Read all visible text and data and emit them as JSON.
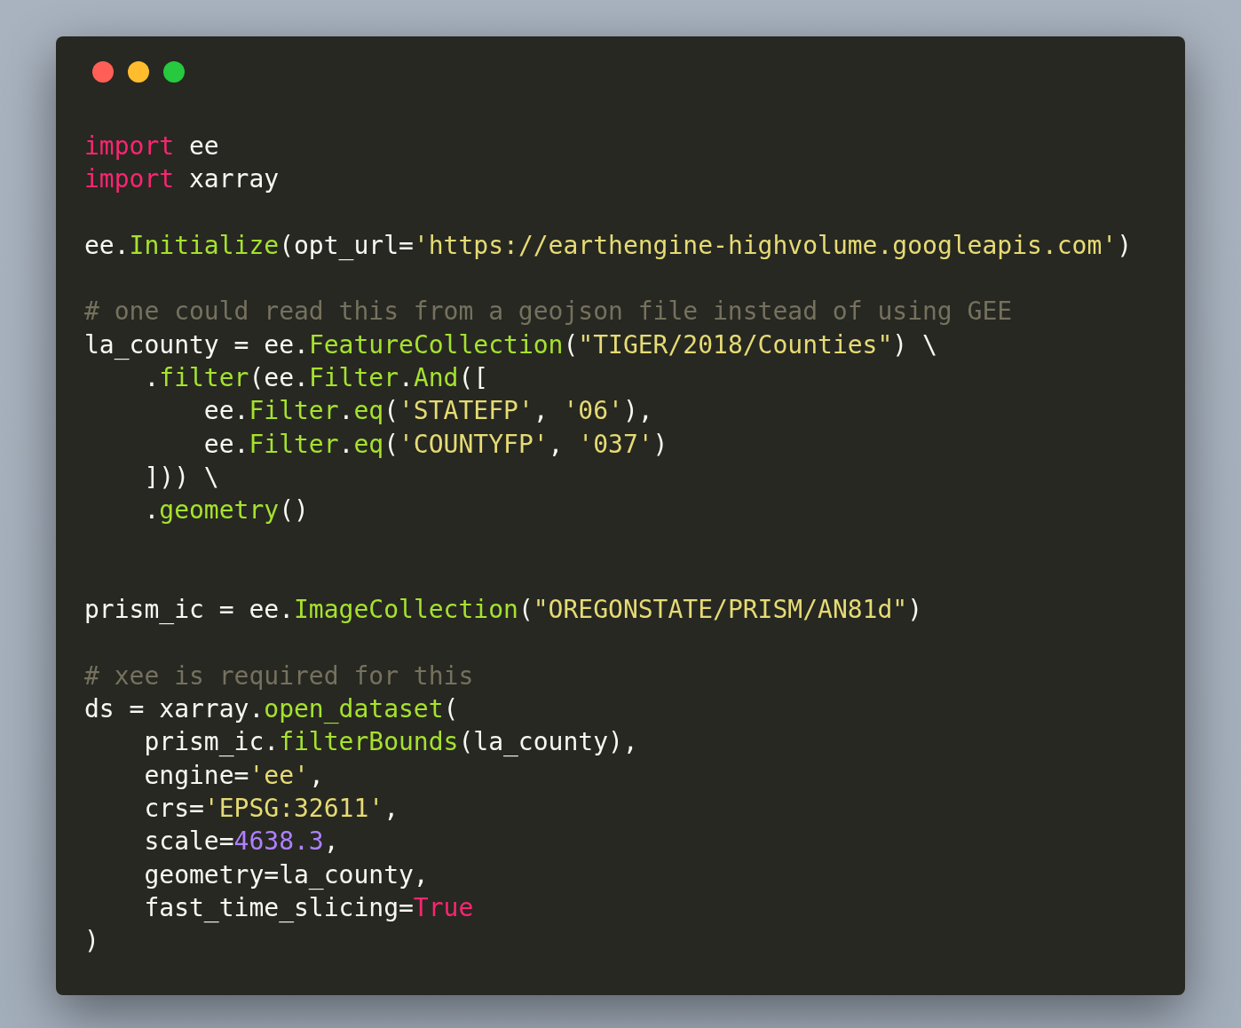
{
  "window": {
    "controls": [
      {
        "kind": "close"
      },
      {
        "kind": "minimize"
      },
      {
        "kind": "zoom"
      }
    ]
  },
  "code": {
    "lines": [
      {
        "kind": "code",
        "tokens": [
          {
            "kind": "keyword",
            "text": "import"
          },
          {
            "kind": "plain",
            "text": " ee"
          }
        ]
      },
      {
        "kind": "code",
        "tokens": [
          {
            "kind": "keyword",
            "text": "import"
          },
          {
            "kind": "plain",
            "text": " xarray"
          }
        ]
      },
      {
        "kind": "blank"
      },
      {
        "kind": "code",
        "tokens": [
          {
            "kind": "plain",
            "text": "ee."
          },
          {
            "kind": "function",
            "text": "Initialize"
          },
          {
            "kind": "plain",
            "text": "(opt_url="
          },
          {
            "kind": "string",
            "text": "'https://earthengine-highvolume.googleapis.com'"
          },
          {
            "kind": "plain",
            "text": ")"
          }
        ]
      },
      {
        "kind": "blank"
      },
      {
        "kind": "code",
        "tokens": [
          {
            "kind": "comment",
            "text": "# one could read this from a geojson file instead of using GEE"
          }
        ]
      },
      {
        "kind": "code",
        "tokens": [
          {
            "kind": "plain",
            "text": "la_county = ee."
          },
          {
            "kind": "function",
            "text": "FeatureCollection"
          },
          {
            "kind": "plain",
            "text": "("
          },
          {
            "kind": "string",
            "text": "\"TIGER/2018/Counties\""
          },
          {
            "kind": "plain",
            "text": ") \\"
          }
        ],
        "children": [
          {
            "kind": "code",
            "tokens": [
              {
                "kind": "member",
                "text": ".filter"
              },
              {
                "kind": "plain",
                "text": "(ee."
              },
              {
                "kind": "function",
                "text": "Filter"
              },
              {
                "kind": "member",
                "text": ".And"
              },
              {
                "kind": "plain",
                "text": "(["
              }
            ],
            "children": [
              {
                "kind": "code",
                "tokens": [
                  {
                    "kind": "plain",
                    "text": "ee."
                  },
                  {
                    "kind": "function",
                    "text": "Filter"
                  },
                  {
                    "kind": "member",
                    "text": ".eq"
                  },
                  {
                    "kind": "plain",
                    "text": "("
                  },
                  {
                    "kind": "string",
                    "text": "'STATEFP'"
                  },
                  {
                    "kind": "plain",
                    "text": ", "
                  },
                  {
                    "kind": "string",
                    "text": "'06'"
                  },
                  {
                    "kind": "plain",
                    "text": "),"
                  }
                ]
              },
              {
                "kind": "code",
                "tokens": [
                  {
                    "kind": "plain",
                    "text": "ee."
                  },
                  {
                    "kind": "function",
                    "text": "Filter"
                  },
                  {
                    "kind": "member",
                    "text": ".eq"
                  },
                  {
                    "kind": "plain",
                    "text": "("
                  },
                  {
                    "kind": "string",
                    "text": "'COUNTYFP'"
                  },
                  {
                    "kind": "plain",
                    "text": ", "
                  },
                  {
                    "kind": "string",
                    "text": "'037'"
                  },
                  {
                    "kind": "plain",
                    "text": ")"
                  }
                ]
              }
            ]
          },
          {
            "kind": "code",
            "tokens": [
              {
                "kind": "plain",
                "text": "])) \\"
              }
            ]
          },
          {
            "kind": "code",
            "tokens": [
              {
                "kind": "member",
                "text": ".geometry"
              },
              {
                "kind": "plain",
                "text": "()"
              }
            ]
          }
        ]
      },
      {
        "kind": "blank"
      },
      {
        "kind": "blank"
      },
      {
        "kind": "code",
        "tokens": [
          {
            "kind": "plain",
            "text": "prism_ic = ee."
          },
          {
            "kind": "function",
            "text": "ImageCollection"
          },
          {
            "kind": "plain",
            "text": "("
          },
          {
            "kind": "string",
            "text": "\"OREGONSTATE/PRISM/AN81d\""
          },
          {
            "kind": "plain",
            "text": ")"
          }
        ]
      },
      {
        "kind": "blank"
      },
      {
        "kind": "code",
        "tokens": [
          {
            "kind": "comment",
            "text": "# xee is required for this"
          }
        ]
      },
      {
        "kind": "code",
        "tokens": [
          {
            "kind": "plain",
            "text": "ds = xarray."
          },
          {
            "kind": "function",
            "text": "open_dataset"
          },
          {
            "kind": "plain",
            "text": "("
          }
        ],
        "children": [
          {
            "kind": "code",
            "tokens": [
              {
                "kind": "plain",
                "text": "prism_ic."
              },
              {
                "kind": "function",
                "text": "filterBounds"
              },
              {
                "kind": "plain",
                "text": "(la_county),"
              }
            ]
          },
          {
            "kind": "code",
            "tokens": [
              {
                "kind": "plain",
                "text": "engine="
              },
              {
                "kind": "string",
                "text": "'ee'"
              },
              {
                "kind": "plain",
                "text": ","
              }
            ]
          },
          {
            "kind": "code",
            "tokens": [
              {
                "kind": "plain",
                "text": "crs="
              },
              {
                "kind": "string",
                "text": "'EPSG:32611'"
              },
              {
                "kind": "plain",
                "text": ","
              }
            ]
          },
          {
            "kind": "code",
            "tokens": [
              {
                "kind": "plain",
                "text": "scale="
              },
              {
                "kind": "number",
                "text": "4638.3"
              },
              {
                "kind": "plain",
                "text": ","
              }
            ]
          },
          {
            "kind": "code",
            "tokens": [
              {
                "kind": "plain",
                "text": "geometry=la_county,"
              }
            ]
          },
          {
            "kind": "code",
            "tokens": [
              {
                "kind": "plain",
                "text": "fast_time_slicing="
              },
              {
                "kind": "keyword",
                "text": "True"
              }
            ]
          }
        ]
      },
      {
        "kind": "code",
        "tokens": [
          {
            "kind": "plain",
            "text": ")"
          }
        ]
      }
    ]
  }
}
